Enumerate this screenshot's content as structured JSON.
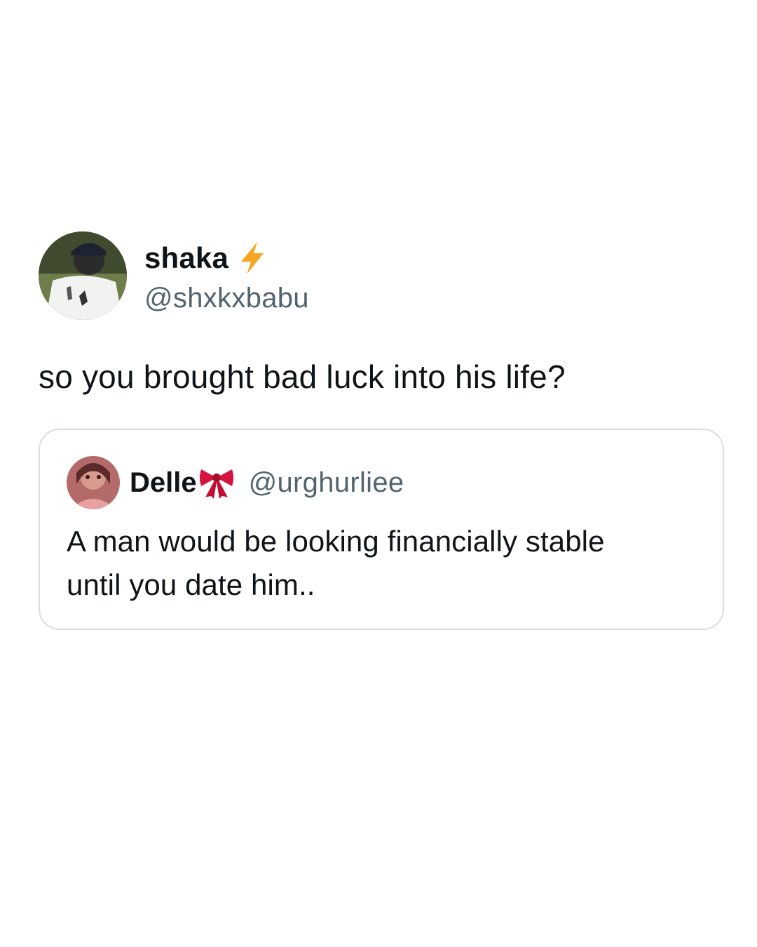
{
  "tweet": {
    "author": {
      "display_name": "shaka",
      "handle": "@shxkxbabu",
      "avatar_icon": "user-avatar-photo",
      "badge_icon": "lightning-bolt-emoji",
      "badge_color": "#f5a623"
    },
    "text": "so you brought bad luck into his life?",
    "quoted_tweet": {
      "author": {
        "display_name": "Delle",
        "handle": "@urghurliee",
        "avatar_icon": "user-avatar-photo",
        "badge_icon": "ribbon-bow-emoji",
        "badge_color": "#d4143c"
      },
      "text_line_1": "A man would be looking financially stable",
      "text_line_2": "until you date him.."
    }
  },
  "colors": {
    "background": "#ffffff",
    "text_primary": "#0f1419",
    "text_secondary": "#536471",
    "card_border": "#d9dee2"
  }
}
